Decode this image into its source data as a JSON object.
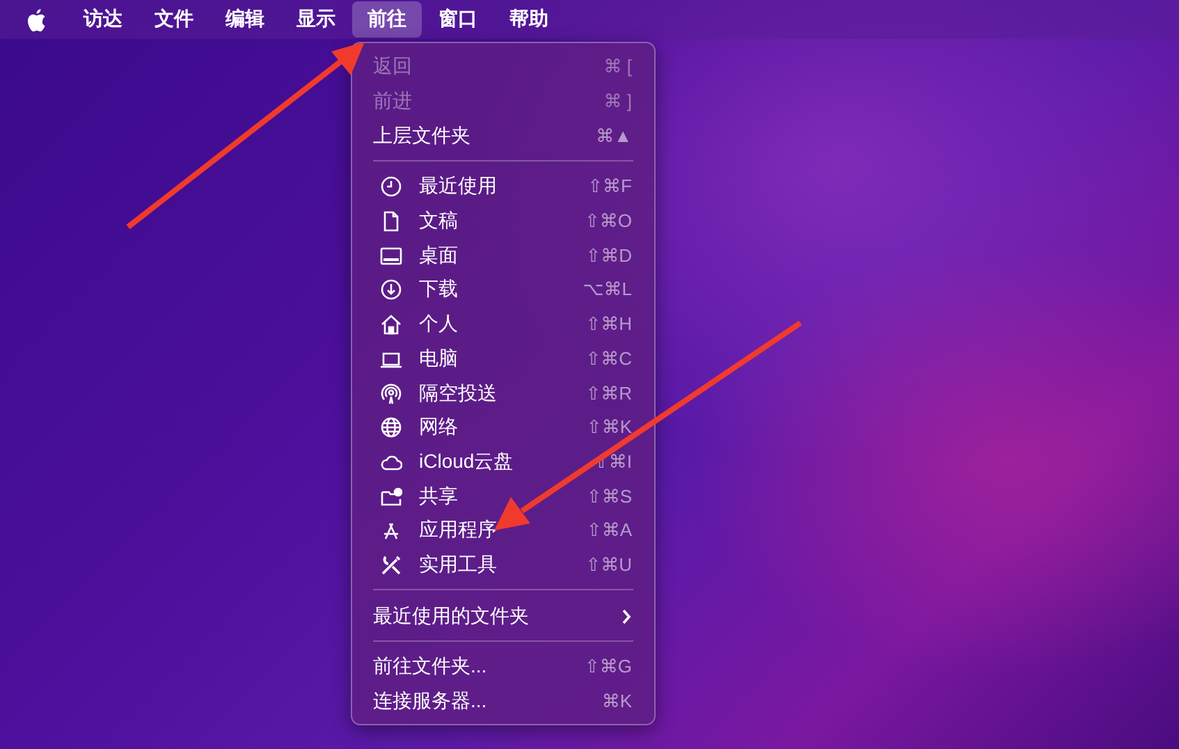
{
  "menubar": [
    {
      "label": "访达",
      "selected": false
    },
    {
      "label": "文件",
      "selected": false
    },
    {
      "label": "编辑",
      "selected": false
    },
    {
      "label": "显示",
      "selected": false
    },
    {
      "label": "前往",
      "selected": true
    },
    {
      "label": "窗口",
      "selected": false
    },
    {
      "label": "帮助",
      "selected": false
    }
  ],
  "menu": {
    "sections": [
      {
        "items": [
          {
            "kind": "plain",
            "label": "返回",
            "shortcut": "⌘ [",
            "disabled": true
          },
          {
            "kind": "plain",
            "label": "前进",
            "shortcut": "⌘ ]",
            "disabled": true
          },
          {
            "kind": "plain",
            "label": "上层文件夹",
            "shortcut": "⌘▲",
            "disabled": false
          }
        ]
      },
      {
        "items": [
          {
            "kind": "icon",
            "label": "最近使用",
            "shortcut": "⇧⌘F",
            "disabled": false
          },
          {
            "kind": "icon",
            "label": "文稿",
            "shortcut": "⇧⌘O",
            "disabled": false
          },
          {
            "kind": "icon",
            "label": "桌面",
            "shortcut": "⇧⌘D",
            "disabled": false
          },
          {
            "kind": "icon",
            "label": "下载",
            "shortcut": "⌥⌘L",
            "disabled": false
          },
          {
            "kind": "icon",
            "label": "个人",
            "shortcut": "⇧⌘H",
            "disabled": false
          },
          {
            "kind": "icon",
            "label": "电脑",
            "shortcut": "⇧⌘C",
            "disabled": false
          },
          {
            "kind": "icon",
            "label": "隔空投送",
            "shortcut": "⇧⌘R",
            "disabled": false
          },
          {
            "kind": "icon",
            "label": "网络",
            "shortcut": "⇧⌘K",
            "disabled": false
          },
          {
            "kind": "icon",
            "label": "iCloud云盘",
            "shortcut": "⇧⌘I",
            "disabled": false
          },
          {
            "kind": "icon",
            "label": "共享",
            "shortcut": "⇧⌘S",
            "disabled": false
          },
          {
            "kind": "icon",
            "label": "应用程序",
            "shortcut": "⇧⌘A",
            "disabled": false
          },
          {
            "kind": "icon",
            "label": "实用工具",
            "shortcut": "⇧⌘U",
            "disabled": false
          }
        ]
      },
      {
        "items": [
          {
            "kind": "submenu",
            "label": "最近使用的文件夹",
            "disabled": false
          }
        ]
      },
      {
        "items": [
          {
            "kind": "plain",
            "label": "前往文件夹...",
            "shortcut": "⇧⌘G",
            "disabled": false
          },
          {
            "kind": "plain",
            "label": "连接服务器...",
            "shortcut": "⌘K",
            "disabled": false
          }
        ]
      }
    ]
  }
}
